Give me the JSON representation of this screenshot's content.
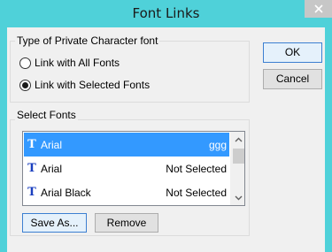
{
  "window": {
    "title": "Font Links"
  },
  "type_group": {
    "label": "Type of Private Character font",
    "options": [
      {
        "label": "Link with All Fonts",
        "selected": false
      },
      {
        "label": "Link with Selected Fonts",
        "selected": true
      }
    ]
  },
  "buttons": {
    "ok": "OK",
    "cancel": "Cancel",
    "save_as": "Save As...",
    "remove": "Remove"
  },
  "fonts_group": {
    "label": "Select Fonts",
    "items": [
      {
        "icon": "truetype-font-icon",
        "name": "Arial",
        "status": "ggg",
        "selected": true
      },
      {
        "icon": "truetype-font-icon",
        "name": "Arial",
        "status": "Not Selected",
        "selected": false
      },
      {
        "icon": "truetype-font-icon",
        "name": "Arial Black",
        "status": "Not Selected",
        "selected": false
      }
    ]
  },
  "colors": {
    "titlebar": "#4fd1d9",
    "selection": "#3399ff",
    "dialog_bg": "#f0f0f0"
  }
}
